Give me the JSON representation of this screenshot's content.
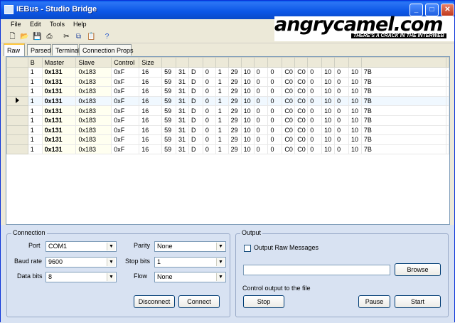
{
  "window": {
    "title": "IEBus - Studio Bridge"
  },
  "menu": [
    "File",
    "Edit",
    "Tools",
    "Help"
  ],
  "logo": {
    "main": "angrycamel.com",
    "tagline": "THERE'S A CRACK IN THE INTERWEB"
  },
  "tabs": [
    "Raw",
    "Parsed",
    "Terminal",
    "Connection Props"
  ],
  "grid": {
    "headers": [
      "B",
      "Master",
      "Slave",
      "Control",
      "Size",
      "",
      "",
      "",
      "",
      "",
      "",
      "",
      "",
      "",
      "",
      "",
      "",
      "",
      "",
      "",
      "",
      ""
    ],
    "rows": [
      [
        "1",
        "0x131",
        "0x183",
        "0xF",
        "16",
        "59",
        "31",
        "D",
        "0",
        "1",
        "29",
        "10",
        "0",
        "0",
        "C0",
        "C0",
        "0",
        "10",
        "0",
        "10",
        "7B"
      ],
      [
        "1",
        "0x131",
        "0x183",
        "0xF",
        "16",
        "59",
        "31",
        "D",
        "0",
        "1",
        "29",
        "10",
        "0",
        "0",
        "C0",
        "C0",
        "0",
        "10",
        "0",
        "10",
        "7B"
      ],
      [
        "1",
        "0x131",
        "0x183",
        "0xF",
        "16",
        "59",
        "31",
        "D",
        "0",
        "1",
        "29",
        "10",
        "0",
        "0",
        "C0",
        "C0",
        "0",
        "10",
        "0",
        "10",
        "7B"
      ],
      [
        "1",
        "0x131",
        "0x183",
        "0xF",
        "16",
        "59",
        "31",
        "D",
        "0",
        "1",
        "29",
        "10",
        "0",
        "0",
        "C0",
        "C0",
        "0",
        "10",
        "0",
        "10",
        "7B"
      ],
      [
        "1",
        "0x131",
        "0x183",
        "0xF",
        "16",
        "59",
        "31",
        "D",
        "0",
        "1",
        "29",
        "10",
        "0",
        "0",
        "C0",
        "C0",
        "0",
        "10",
        "0",
        "10",
        "7B"
      ],
      [
        "1",
        "0x131",
        "0x183",
        "0xF",
        "16",
        "59",
        "31",
        "D",
        "0",
        "1",
        "29",
        "10",
        "0",
        "0",
        "C0",
        "C0",
        "0",
        "10",
        "0",
        "10",
        "7B"
      ],
      [
        "1",
        "0x131",
        "0x183",
        "0xF",
        "16",
        "59",
        "31",
        "D",
        "0",
        "1",
        "29",
        "10",
        "0",
        "0",
        "C0",
        "C0",
        "0",
        "10",
        "0",
        "10",
        "7B"
      ],
      [
        "1",
        "0x131",
        "0x183",
        "0xF",
        "16",
        "59",
        "31",
        "D",
        "0",
        "1",
        "29",
        "10",
        "0",
        "0",
        "C0",
        "C0",
        "0",
        "10",
        "0",
        "10",
        "7B"
      ],
      [
        "1",
        "0x131",
        "0x183",
        "0xF",
        "16",
        "59",
        "31",
        "D",
        "0",
        "1",
        "29",
        "10",
        "0",
        "0",
        "C0",
        "C0",
        "0",
        "10",
        "0",
        "10",
        "7B"
      ]
    ],
    "selected_row": 3
  },
  "connection": {
    "title": "Connection",
    "port_label": "Port",
    "port_value": "COM1",
    "baud_label": "Baud rate",
    "baud_value": "9600",
    "data_label": "Data bits",
    "data_value": "8",
    "parity_label": "Parity",
    "parity_value": "None",
    "stop_label": "Stop bits",
    "stop_value": "1",
    "flow_label": "Flow",
    "flow_value": "None",
    "disconnect": "Disconnect",
    "connect": "Connect"
  },
  "output": {
    "title": "Output",
    "raw_label": "Output Raw Messages",
    "browse": "Browse",
    "control_label": "Control output to the file",
    "stop": "Stop",
    "pause": "Pause",
    "start": "Start"
  }
}
